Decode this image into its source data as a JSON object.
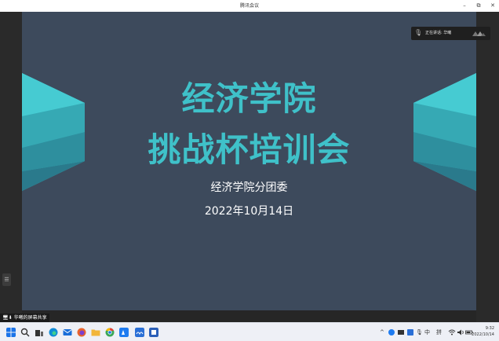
{
  "window": {
    "title": "腾讯会议",
    "minimize": "–",
    "maximize": "⧉",
    "close": "✕"
  },
  "slide": {
    "title_line1": "经济学院",
    "title_line2": "挑战杯培训会",
    "organizer": "经济学院分团委",
    "date": "2022年10月14日",
    "accent_color": "#3fc1c9",
    "background_color": "#3d4a5c"
  },
  "speaking_indicator": {
    "label": "正在讲话: 华曦"
  },
  "share_label": "华曦的屏幕共享",
  "side_handle": "☰",
  "taskbar": {
    "apps": [
      {
        "name": "start-icon",
        "color": "#1a73e8"
      },
      {
        "name": "search-icon",
        "color": "#333333"
      },
      {
        "name": "task-view-icon",
        "color": "#333333"
      },
      {
        "name": "edge-icon",
        "color": "#0f8bd6"
      },
      {
        "name": "mail-icon",
        "color": "#1a6ed8"
      },
      {
        "name": "firefox-icon",
        "color": "#e8642d"
      },
      {
        "name": "folder-icon",
        "color": "#f2b63a"
      },
      {
        "name": "chrome-icon",
        "color": "#3aa757"
      },
      {
        "name": "tencent-meeting-icon",
        "color": "#1e7bf0"
      },
      {
        "name": "app-icon",
        "color": "#2a6fd6"
      },
      {
        "name": "word-icon",
        "color": "#2b5fb8"
      }
    ],
    "tray": {
      "ime_mode": "中",
      "ime_layout": "拼"
    },
    "clock_time": "9:32",
    "clock_date": "2022/10/14"
  }
}
